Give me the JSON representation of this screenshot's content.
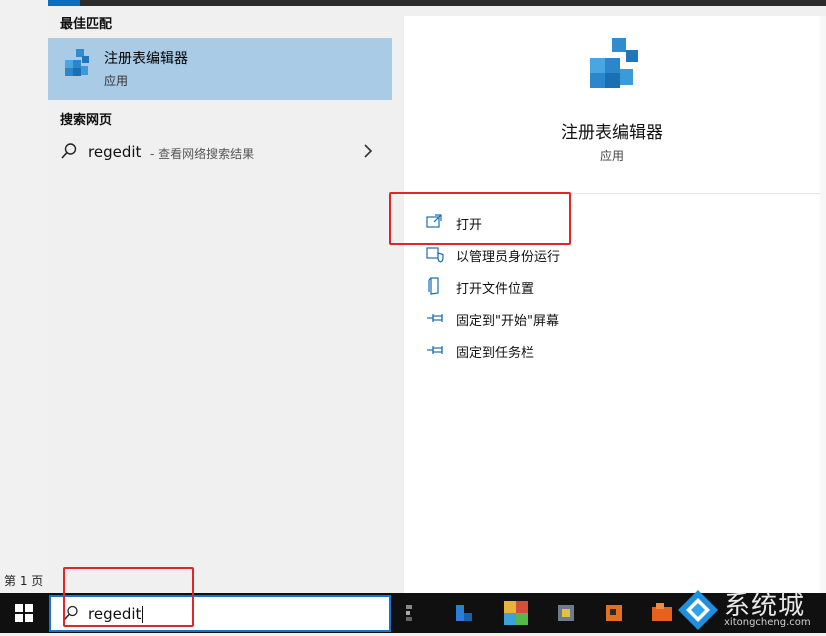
{
  "document": {
    "page_indicator": "第 1 页"
  },
  "results": {
    "best_match_header": "最佳匹配",
    "best_match": {
      "title": "注册表编辑器",
      "subtitle": "应用",
      "icon": "registry-editor-icon"
    },
    "web_header": "搜索网页",
    "web_result": {
      "query": "regedit",
      "description": "- 查看网络搜索结果",
      "icon": "search-icon"
    }
  },
  "detail": {
    "title": "注册表编辑器",
    "subtitle": "应用",
    "actions": [
      {
        "label": "打开",
        "icon": "open-icon"
      },
      {
        "label": "以管理员身份运行",
        "icon": "shield-icon"
      },
      {
        "label": "打开文件位置",
        "icon": "file-location-icon"
      },
      {
        "label": "固定到\"开始\"屏幕",
        "icon": "pin-icon"
      },
      {
        "label": "固定到任务栏",
        "icon": "pin-icon"
      }
    ]
  },
  "taskbar": {
    "search_value": "regedit",
    "watermark": "系统城",
    "watermark_url": "xitongcheng.com"
  },
  "colors": {
    "selection": "#a9cbe6",
    "accent": "#1a73c7",
    "annotation_red": "#e0262b",
    "taskbar": "#101010"
  }
}
